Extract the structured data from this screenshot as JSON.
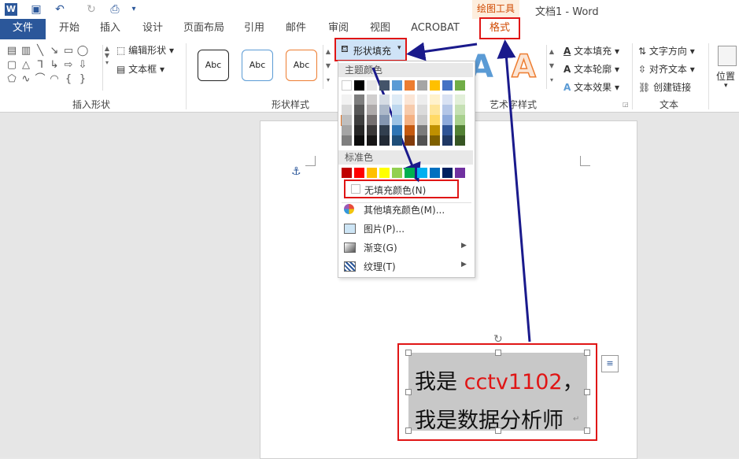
{
  "titlebar": {
    "contextual_group": "绘图工具",
    "document_title": "文档1 - Word"
  },
  "tabs": [
    "文件",
    "开始",
    "插入",
    "设计",
    "页面布局",
    "引用",
    "邮件",
    "审阅",
    "视图",
    "ACROBAT",
    "格式"
  ],
  "ribbon": {
    "insert_shapes": {
      "edit_shape": "编辑形状",
      "text_box": "文本框",
      "label": "插入形状"
    },
    "shape_styles": {
      "preset": [
        "Abc",
        "Abc",
        "Abc"
      ],
      "shape_fill": "形状填充",
      "label": "形状样式"
    },
    "art_styles": {
      "text_fill": "文本填充",
      "text_outline": "文本轮廓",
      "text_effects": "文本效果",
      "label": "艺术字样式"
    },
    "text": {
      "text_direction": "文字方向",
      "align_text": "对齐文本",
      "create_link": "创建链接",
      "label": "文本"
    },
    "arrange": {
      "position": "位置"
    }
  },
  "dropdown": {
    "theme_colors_header": "主题颜色",
    "standard_colors_header": "标准色",
    "theme_top_row": [
      "#ffffff",
      "#000000",
      "#e7e6e6",
      "#44546a",
      "#5b9bd5",
      "#ed7d31",
      "#a5a5a5",
      "#ffc000",
      "#4472c4",
      "#70ad47"
    ],
    "theme_shades": [
      [
        "#f2f2f2",
        "#7f7f7f",
        "#d0cece",
        "#d6dce4",
        "#deebf6",
        "#fbe5d5",
        "#ededed",
        "#fff2cc",
        "#d9e2f3",
        "#e2efd9"
      ],
      [
        "#d8d8d8",
        "#595959",
        "#aeaaaa",
        "#adb9ca",
        "#bdd7ee",
        "#f7cbac",
        "#dbdbdb",
        "#fee599",
        "#b4c6e7",
        "#c5e0b3"
      ],
      [
        "#bfbfbf",
        "#3f3f3f",
        "#757070",
        "#8496b0",
        "#9cc3e5",
        "#f4b183",
        "#c9c9c9",
        "#ffd965",
        "#8eaadb",
        "#a8d08d"
      ],
      [
        "#a5a5a5",
        "#262626",
        "#3a3838",
        "#323f4f",
        "#2e75b5",
        "#c55a11",
        "#7b7b7b",
        "#bf9000",
        "#2f5496",
        "#538135"
      ],
      [
        "#7f7f7f",
        "#0c0c0c",
        "#171616",
        "#222a35",
        "#1e4e79",
        "#833c0b",
        "#525252",
        "#7f6000",
        "#1f3864",
        "#375623"
      ]
    ],
    "standard_colors": [
      "#c00000",
      "#ff0000",
      "#ffc000",
      "#ffff00",
      "#92d050",
      "#00b050",
      "#00b0f0",
      "#0070c0",
      "#002060",
      "#7030a0"
    ],
    "no_fill": "无填充颜色(N)",
    "more_colors": "其他填充颜色(M)...",
    "picture": "图片(P)...",
    "gradient": "渐变(G)",
    "texture": "纹理(T)"
  },
  "textbox": {
    "line1_prefix": "我是 ",
    "line1_highlight": "cctv1102",
    "line1_suffix": "，",
    "line2": "我是数据分析师",
    "highlight_color": "#e01515"
  }
}
